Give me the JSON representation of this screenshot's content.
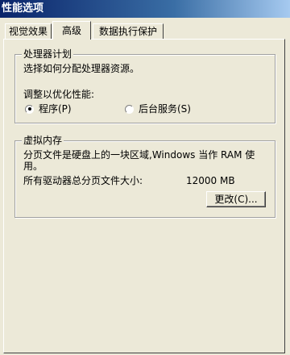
{
  "window": {
    "title": "性能选项"
  },
  "tabs": [
    {
      "label": "视觉效果"
    },
    {
      "label": "高级"
    },
    {
      "label": "数据执行保护"
    }
  ],
  "processor": {
    "group_title": "处理器计划",
    "description": "选择如何分配处理器资源。",
    "optimize_label": "调整以优化性能:",
    "options": [
      {
        "label": "程序(P)",
        "checked": true
      },
      {
        "label": "后台服务(S)",
        "checked": false
      }
    ]
  },
  "virtual_memory": {
    "group_title": "虚拟内存",
    "description": "分页文件是硬盘上的一块区域,Windows 当作 RAM 使用。",
    "total_label": "所有驱动器总分页文件大小:",
    "total_value": "12000 MB",
    "change_button": "更改(C)..."
  },
  "annotation": {
    "color": "#ff0000"
  }
}
